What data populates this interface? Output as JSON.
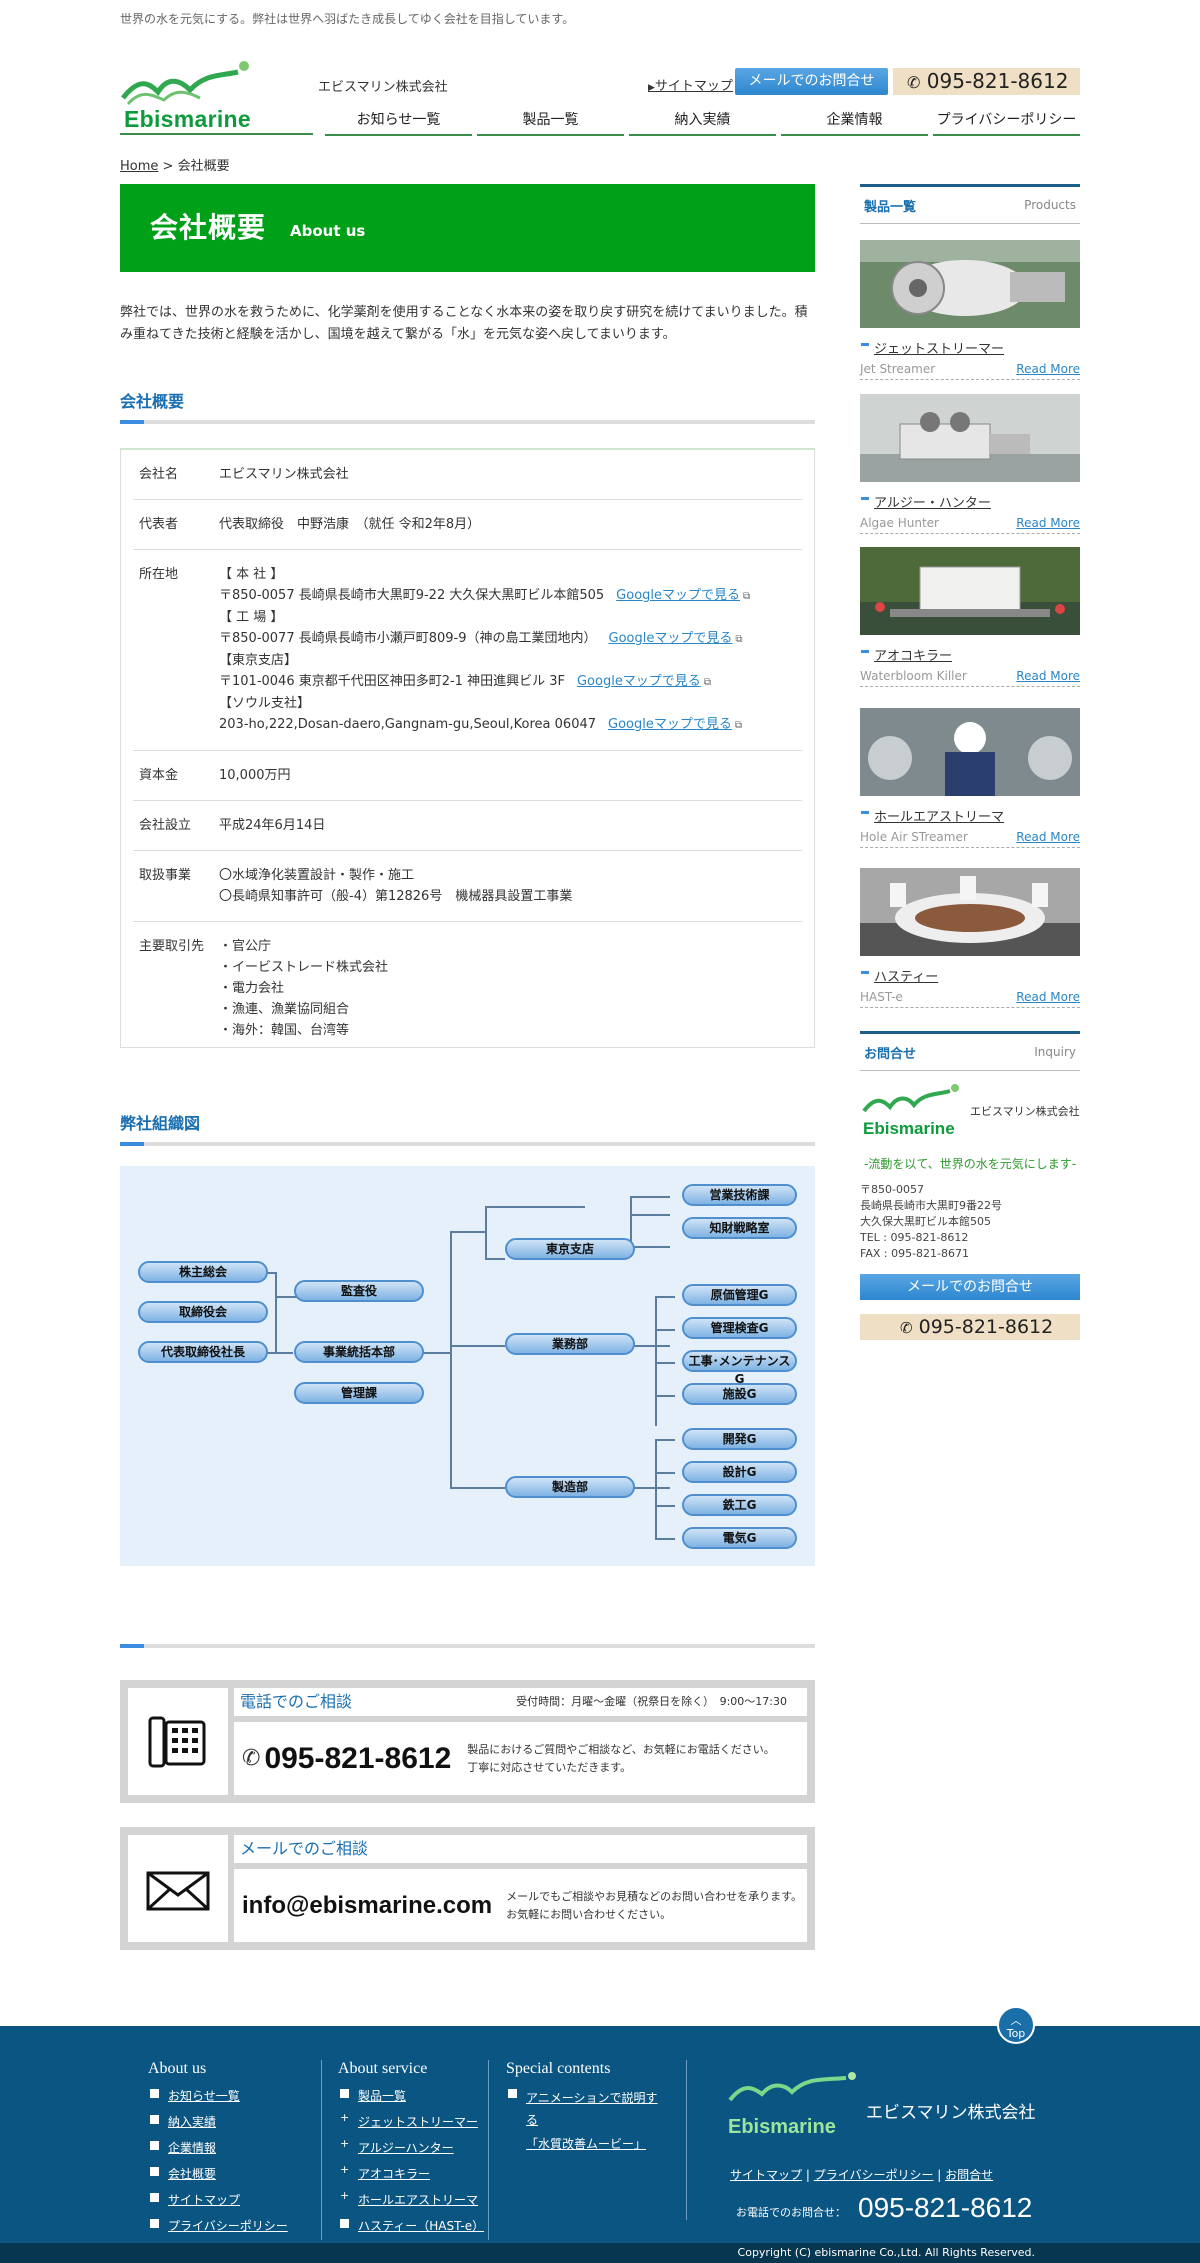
{
  "header": {
    "tagline": "世界の水を元気にする。弊社は世界へ羽ばたき成長してゆく会社を目指しています。",
    "logo_text": "Ebismarine",
    "company_name": "エビスマリン株式会社",
    "sitemap_link": "サイトマップ",
    "mail_button": "メールでのお問合せ",
    "phone": "095-821-8612",
    "nav": [
      "お知らせ一覧",
      "製品一覧",
      "納入実績",
      "企業情報",
      "プライバシーポリシー"
    ]
  },
  "breadcrumb": {
    "home": "Home",
    "sep": ">",
    "current": "会社概要"
  },
  "hero": {
    "title_jp": "会社概要",
    "title_en": "About us"
  },
  "intro": "弊社では、世界の水を救うために、化学薬剤を使用することなく水本来の姿を取り戻す研究を続けてまいりました。積み重ねてきた技術と経験を活かし、国境を越えて繋がる「水」を元気な姿へ戻してまいります。",
  "overview": {
    "title": "会社概要",
    "rows": {
      "name": {
        "label": "会社名",
        "value": "エビスマリン株式会社"
      },
      "rep": {
        "label": "代表者",
        "value": "代表取締役　中野浩康　（就任 令和2年8月）"
      },
      "address": {
        "label": "所在地",
        "hq_head": "【 本 社 】",
        "hq": "〒850-0057  長崎県長崎市大黒町9-22 大久保大黒町ビル本館505",
        "factory_head": "【 工 場 】",
        "factory": "〒850-0077  長崎県長崎市小瀬戸町809-9（神の島工業団地内）",
        "tokyo_head": "【東京支店】",
        "tokyo": "〒101-0046  東京都千代田区神田多町2-1 神田進興ビル 3F",
        "seoul_head": "【ソウル支社】",
        "seoul": "203-ho,222,Dosan-daero,Gangnam-gu,Seoul,Korea 06047",
        "map_link": "Googleマップで見る"
      },
      "capital": {
        "label": "資本金",
        "value": "10,000万円"
      },
      "founded": {
        "label": "会社設立",
        "value": "平成24年6月14日"
      },
      "business": {
        "label": "取扱事業",
        "line1": "〇水域浄化装置設計・製作・施工",
        "line2": "〇長崎県知事許可（般-4）第12826号　機械器具設置工事業"
      },
      "clients": {
        "label": "主要取引先",
        "items": [
          "・官公庁",
          "・イービストレード株式会社",
          "・電力会社",
          "・漁連、漁業協同組合",
          "・海外：韓国、台湾等"
        ]
      }
    }
  },
  "org": {
    "title": "弊社組織図",
    "nodes": {
      "shareholders": "株主総会",
      "board": "取締役会",
      "president": "代表取締役社長",
      "auditor": "監査役",
      "hq_dept": "事業統括本部",
      "admin": "管理課",
      "tokyo": "東京支店",
      "business": "業務部",
      "manufacturing": "製造部",
      "sales_tech": "営業技術課",
      "ip": "知財戦略室",
      "cost": "原価管理G",
      "inspection": "管理検査G",
      "construction": "工事･メンテナンスG",
      "facilities": "施設G",
      "dev": "開発G",
      "design": "設計G",
      "steel": "鉄工G",
      "electric": "電気G"
    }
  },
  "contact_phone": {
    "title": "電話でのご相談",
    "hours": "受付時間：月曜～金曜（祝祭日を除く）　9:00～17:30",
    "number": "095-821-8612",
    "desc1": "製品におけるご質問やご相談など、お気軽にお電話ください。",
    "desc2": "丁寧に対応させていただきます。"
  },
  "contact_mail": {
    "title": "メールでのご相談",
    "email": "info@ebismarine.com",
    "desc1": "メールでもご相談やお見積などのお問い合わせを承ります。",
    "desc2": "お気軽にお問い合わせください。"
  },
  "sidebar": {
    "products_title": "製品一覧",
    "products_en": "Products",
    "read_more": "Read More",
    "products": [
      {
        "name": "ジェットストリーマー",
        "en": "Jet Streamer"
      },
      {
        "name": "アルジー・ハンター",
        "en": "Algae Hunter"
      },
      {
        "name": "アオコキラー",
        "en": "Waterbloom Killer"
      },
      {
        "name": "ホールエアストリーマ",
        "en": "Hole Air STreamer"
      },
      {
        "name": "ハスティー",
        "en": "HAST-e"
      }
    ],
    "inquiry_title": "お問合せ",
    "inquiry_en": "Inquiry",
    "logo_text": "Ebismarine",
    "company_name": "エビスマリン株式会社",
    "slogan": "-流動を以て、世界の水を元気にします-",
    "postal": "〒850-0057",
    "addr1": "長崎県長崎市大黒町9番22号",
    "addr2": "大久保大黒町ビル本館505",
    "tel": "TEL : 095-821-8612",
    "fax": "FAX : 095-821-8671",
    "mail_button": "メールでのお問合せ",
    "phone": "095-821-8612"
  },
  "footer": {
    "top_label": "Top",
    "about_us": {
      "title": "About us",
      "items": [
        "お知らせ一覧",
        "納入実績",
        "企業情報",
        "会社概要",
        "サイトマップ",
        "プライバシーポリシー"
      ]
    },
    "about_service": {
      "title": "About service",
      "items": [
        "製品一覧",
        "ジェットストリーマー",
        "アルジーハンター",
        "アオコキラー",
        "ホールエアストリーマ",
        "ハスティー（HAST-e）"
      ]
    },
    "special": {
      "title": "Special contents",
      "item1a": "アニメーションで説明す",
      "item1b": "る",
      "item2": "「水質改善ムービー」"
    },
    "logo_text": "Ebismarine",
    "company_name": "エビスマリン株式会社",
    "links": [
      "サイトマップ",
      "プライバシーポリシー",
      "お問合せ"
    ],
    "phone_label": "お電話でのお問合せ：",
    "phone": "095-821-8612",
    "copyright": "Copyright (C) ebismarine Co.,Ltd. All Rights Reserved."
  }
}
